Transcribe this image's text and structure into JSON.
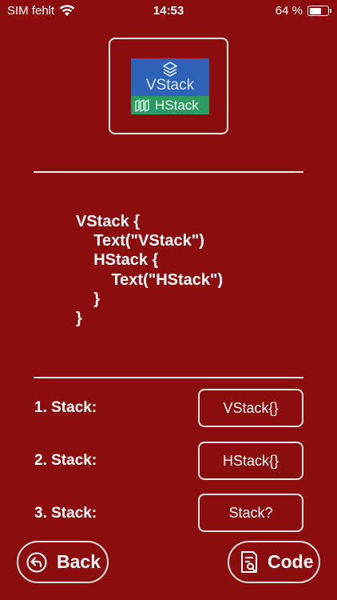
{
  "status_bar": {
    "carrier": "SIM fehlt",
    "time": "14:53",
    "battery_percent": "64 %",
    "battery_level": 0.64
  },
  "preview": {
    "vstack_label": "VStack",
    "hstack_label": "HStack",
    "vstack_color": "#2e62b6",
    "hstack_color": "#2d9a63"
  },
  "code_lines": [
    "VStack {",
    "    Text(\"VStack\")",
    "    HStack {",
    "        Text(\"HStack\")",
    "    }",
    "}"
  ],
  "quiz": [
    {
      "label": "1. Stack:",
      "answer": "VStack{}"
    },
    {
      "label": "2. Stack:",
      "answer": "HStack{}"
    },
    {
      "label": "3. Stack:",
      "answer": "Stack?"
    }
  ],
  "buttons": {
    "back": "Back",
    "code": "Code"
  },
  "colors": {
    "background": "#8b0d0d",
    "foreground": "#ffffff"
  }
}
